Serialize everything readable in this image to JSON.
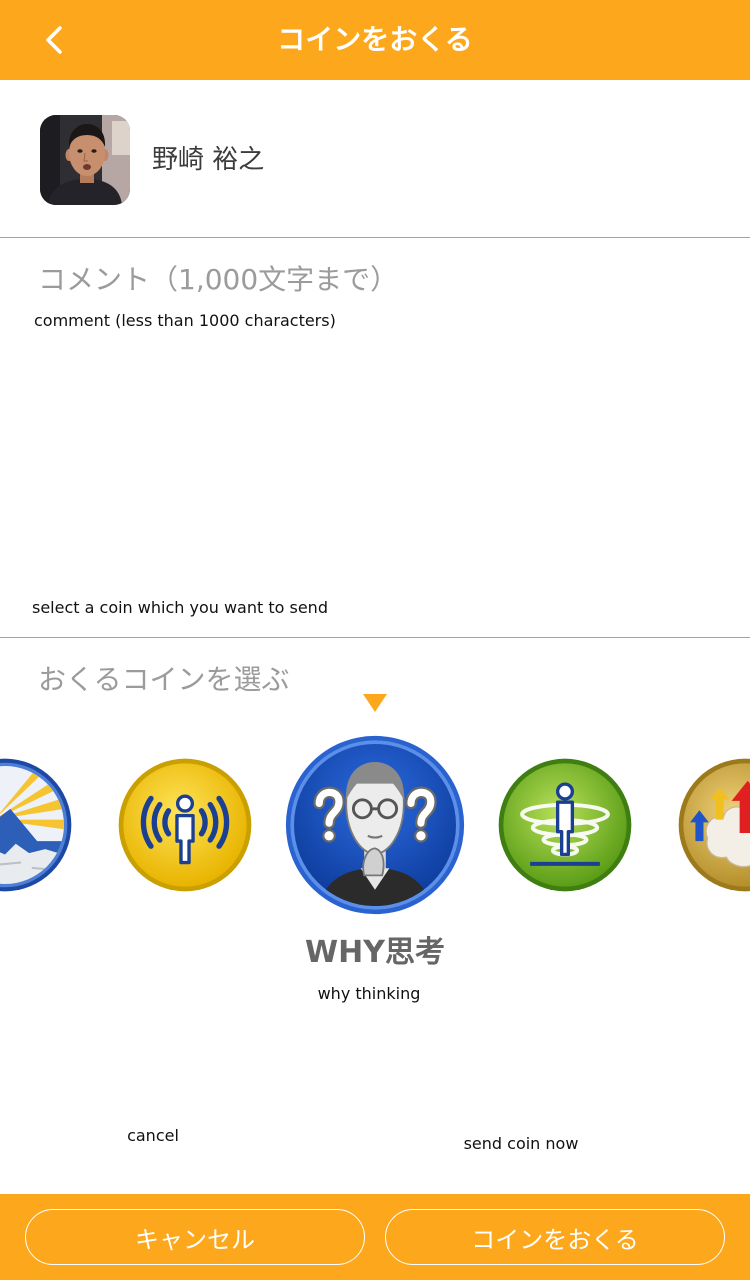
{
  "colors": {
    "accent": "#FDA81C",
    "text_primary": "#3c3c3c",
    "text_muted": "#9b9b9b",
    "divider": "#a3a3a3",
    "selected_label": "#666666"
  },
  "header": {
    "title": "コインをおくる",
    "back_icon": "chevron-left-icon"
  },
  "recipient": {
    "name": "野崎 裕之",
    "avatar_icon": "user-photo-avatar"
  },
  "comment": {
    "placeholder": "コメント（1,000文字まで）",
    "annotation": "comment (less than 1000 characters)"
  },
  "coin_select": {
    "annotation": "select a coin which you want to send",
    "heading": "おくるコインを選ぶ",
    "indicator_icon": "triangle-down-icon",
    "coins": [
      {
        "icon": "mountain-city-coin-icon",
        "color": "#1d48a3",
        "selected": false
      },
      {
        "icon": "broadcast-person-coin-icon",
        "color": "#f2c21a",
        "selected": false
      },
      {
        "icon": "why-thinking-coin-icon",
        "color": "#1e56c8",
        "selected": true
      },
      {
        "icon": "tornado-person-coin-icon",
        "color": "#6fb024",
        "selected": false
      },
      {
        "icon": "growth-arrows-coin-icon",
        "color": "#c39a35",
        "selected": false
      }
    ],
    "selected_name": "WHY思考",
    "selected_annotation": "why thinking"
  },
  "footer": {
    "cancel_label": "キャンセル",
    "cancel_annotation": "cancel",
    "send_label": "コインをおくる",
    "send_annotation": "send coin now"
  }
}
